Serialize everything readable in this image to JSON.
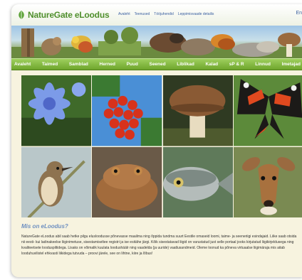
{
  "header": {
    "logo_text": "NatureGate eLoodus",
    "links": [
      "Avaleht",
      "Teenused",
      "Tööjuhendid",
      "Leppimisvaade detailis"
    ],
    "lang": "En"
  },
  "nav": [
    "Avaleht",
    "Taimed",
    "Samblad",
    "Herned",
    "Puud",
    "Seened",
    "Liblikad",
    "Kalad",
    "sP & R",
    "Linnud",
    "Imetajad"
  ],
  "tiles": [
    "cornflower",
    "rowan-berries",
    "mushroom",
    "red-admiral-butterfly",
    "warbler-bird",
    "toad",
    "fish",
    "roe-deer"
  ],
  "content": {
    "heading": "Mis on eLoodus?",
    "body": "NatureGate eLoodus abil saab hetke pilgu elusloodusse põnevasse maailma ning õppida tundma suurt Eestile omaseid loomi, taime- ja seeneriigi esindajaid. Liike saab otsida nii eesti- kui ladinakeelse liiginimetuse, sisestamiseltee registri ja ise esitähe järgi. Kõik sisestatavad liigid on varustatud just selle portaal jooks kirjutatud liigikirjeldusega ning kvaliteetsete looduspiltidega. Lisaks on võimalik kuulata loodushäälr ning vaadelda (ja uuride) vaatlusandmeid. Oleme loonud ka põneva virtuaalse liigimäraja mis aitab looduhuvilistel ehkvasti liikidega tutvuda – proovi järele, see on lihtne, kiire ja lõbus!"
  },
  "colors": {
    "nav_green": "#7cb342",
    "logo_green": "#4f8f2c",
    "heading_blue": "#6d8fc0",
    "background": "#f7f3df"
  }
}
